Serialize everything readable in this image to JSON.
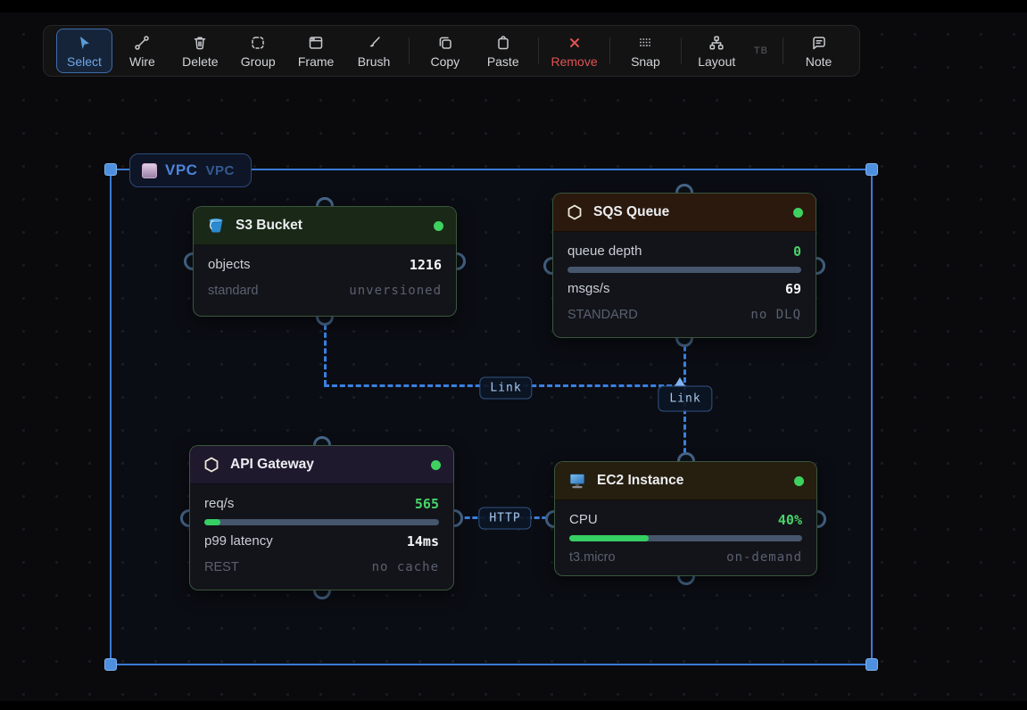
{
  "toolbar": {
    "tools": [
      {
        "label": "Select"
      },
      {
        "label": "Wire"
      },
      {
        "label": "Delete"
      },
      {
        "label": "Group"
      },
      {
        "label": "Frame"
      },
      {
        "label": "Brush"
      },
      {
        "label": "Copy"
      },
      {
        "label": "Paste"
      },
      {
        "label": "Remove"
      },
      {
        "label": "Snap"
      },
      {
        "label": "Layout"
      },
      {
        "label": "Note"
      }
    ],
    "layout_direction": "TB"
  },
  "frame": {
    "title": "VPC",
    "type": "VPC"
  },
  "nodes": {
    "s3": {
      "title": "S3 Bucket",
      "rows": {
        "objects_label": "objects",
        "objects_value": "1216",
        "meta_left": "standard",
        "meta_right": "unversioned"
      }
    },
    "sqs": {
      "title": "SQS Queue",
      "rows": {
        "depth_label": "queue depth",
        "depth_value": "0",
        "depth_pct": 0,
        "rate_label": "msgs/s",
        "rate_value": "69",
        "meta_left": "STANDARD",
        "meta_right": "no DLQ"
      }
    },
    "api": {
      "title": "API Gateway",
      "rows": {
        "rps_label": "req/s",
        "rps_value": "565",
        "rps_pct": 7,
        "latency_label": "p99 latency",
        "latency_value": "14ms",
        "meta_left": "REST",
        "meta_right": "no cache"
      }
    },
    "ec2": {
      "title": "EC2 Instance",
      "rows": {
        "cpu_label": "CPU",
        "cpu_value": "40%",
        "cpu_pct": 34,
        "meta_left": "t3.micro",
        "meta_right": "on-demand"
      }
    }
  },
  "wires": {
    "s3_to_sqs_label": "Link",
    "sqs_to_ec2_label": "Link",
    "api_to_ec2_label": "HTTP"
  },
  "colors": {
    "wire_blue": "#3b7fe0",
    "frame_blue": "#3a7bd5",
    "status_green": "#3ed160",
    "value_green": "#49d36a",
    "danger_red": "#e05252",
    "bar_track": "#46566c",
    "bar_fill": "#36cf63"
  }
}
